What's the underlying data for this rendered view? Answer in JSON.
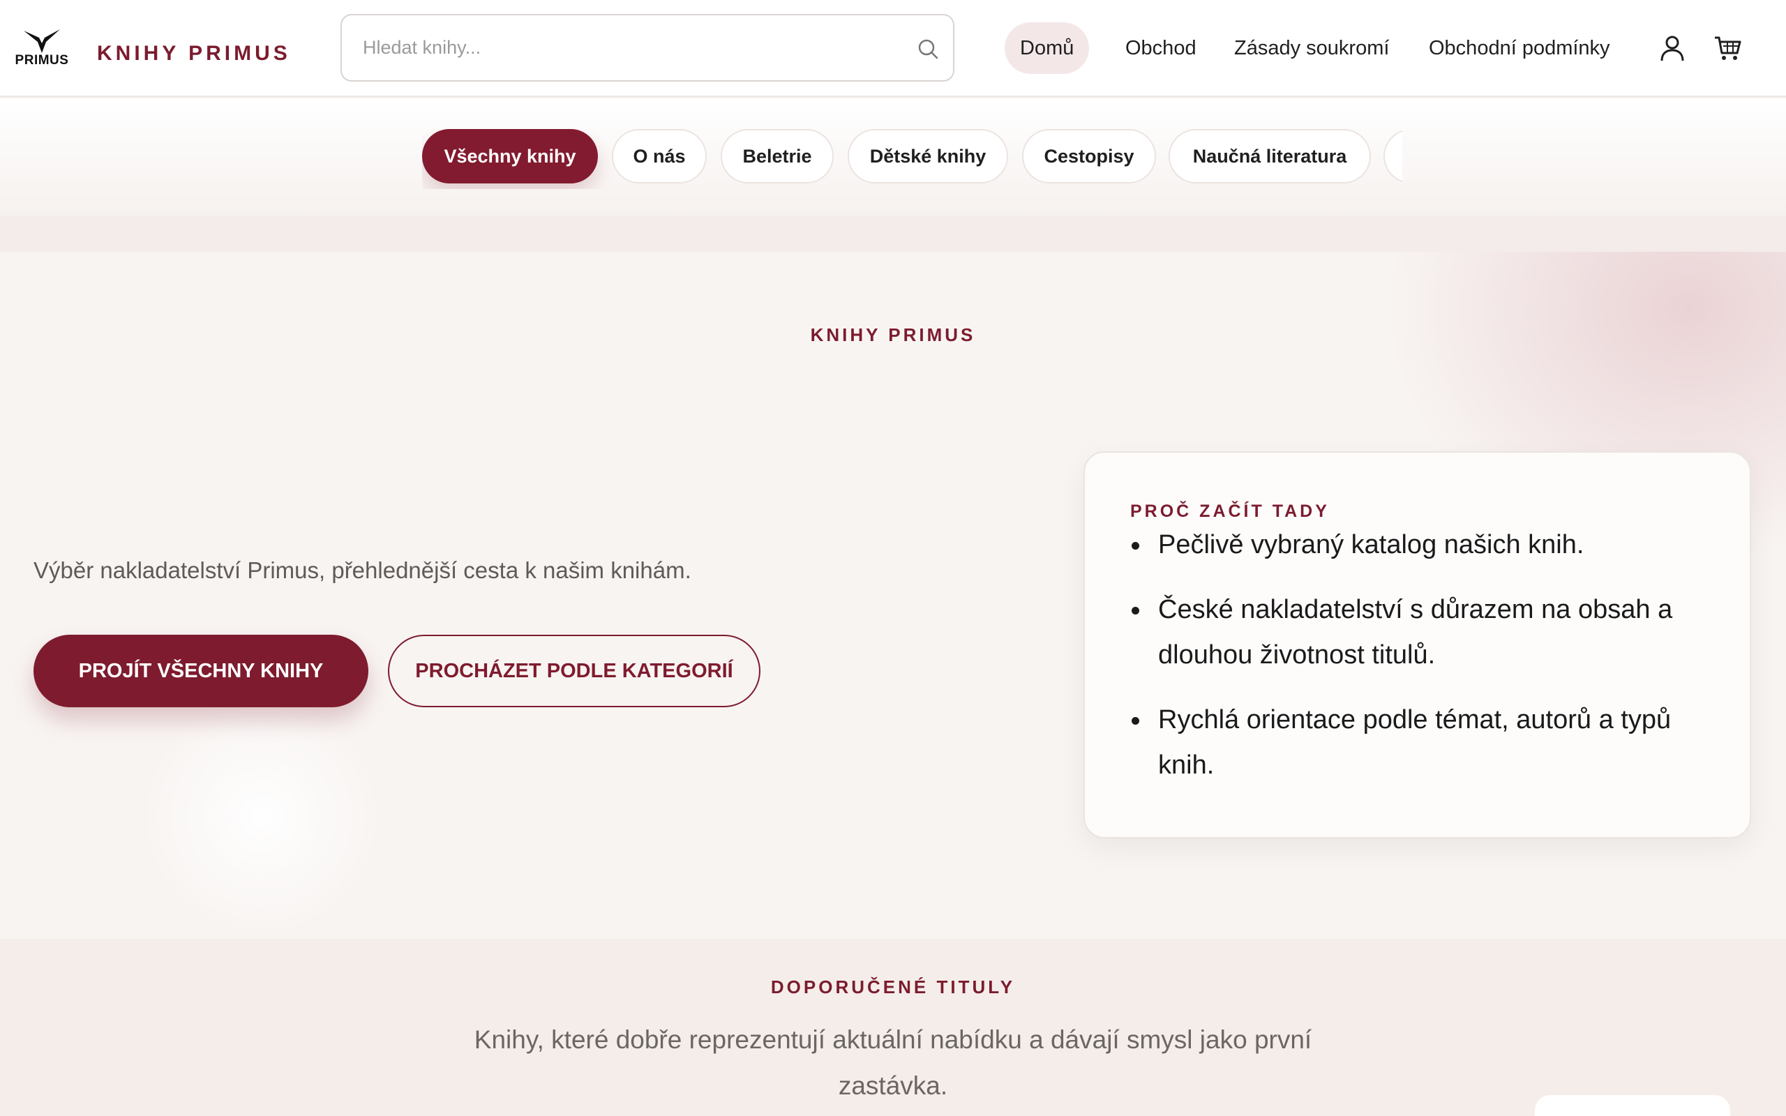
{
  "header": {
    "logo_text": "PRIMUS",
    "brand": "KNIHY PRIMUS",
    "search": {
      "placeholder": "Hledat knihy..."
    },
    "nav": [
      {
        "label": "Domů",
        "active": true
      },
      {
        "label": "Obchod"
      },
      {
        "label": "Zásady soukromí"
      },
      {
        "label": "Obchodní podmínky"
      }
    ]
  },
  "categories": [
    {
      "label": "Všechny knihy",
      "active": true
    },
    {
      "label": "O nás"
    },
    {
      "label": "Beletrie"
    },
    {
      "label": "Dětské knihy"
    },
    {
      "label": "Cestopisy"
    },
    {
      "label": "Naučná literatura"
    }
  ],
  "hero": {
    "eyebrow": "KNIHY PRIMUS",
    "subtitle": "Výběr nakladatelství Primus, přehlednější cesta k našim knihám.",
    "primary_button": "PROJÍT VŠECHNY KNIHY",
    "secondary_button": "PROCHÁZET PODLE KATEGORIÍ"
  },
  "why": {
    "title": "PROČ ZAČÍT TADY",
    "items": [
      "Pečlivě vybraný katalog našich knih.",
      "České nakladatelství s důrazem na obsah a dlouhou životnost titulů.",
      "Rychlá orientace podle témat, autorů a typů knih."
    ]
  },
  "recommended": {
    "eyebrow": "DOPORUČENÉ TITULY",
    "subtitle": "Knihy, které dobře reprezentují aktuální nabídku a dávají smysl jako první zastávka."
  },
  "colors": {
    "accent": "#7e1b2e",
    "nav_active_bg": "#f3e7e8",
    "page_bg": "#f8f4f2"
  }
}
